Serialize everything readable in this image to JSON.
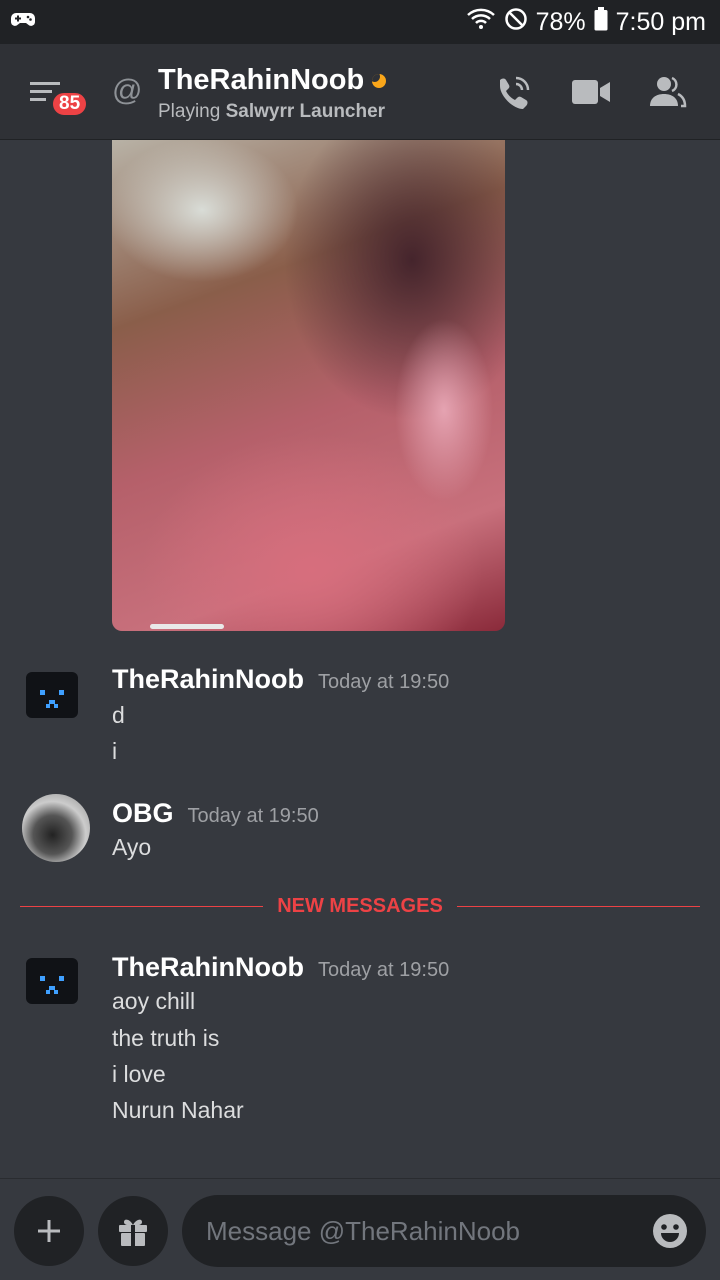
{
  "status_bar": {
    "app_icon": "gamepad-icon",
    "battery_percent": "78%",
    "time": "7:50 pm"
  },
  "header": {
    "notification_count": "85",
    "channel_symbol": "@",
    "username": "TheRahinNoob",
    "activity_prefix": "Playing",
    "activity_name": "Salwyrr Launcher",
    "status": "idle"
  },
  "messages": [
    {
      "author": "TheRahinNoob",
      "timestamp": "Today at 19:50",
      "lines": [
        "d",
        "i"
      ]
    },
    {
      "author": "OBG",
      "timestamp": "Today at 19:50",
      "lines": [
        "Ayo"
      ]
    },
    {
      "author": "TheRahinNoob",
      "timestamp": "Today at 19:50",
      "lines": [
        "aoy chill",
        "the truth is",
        "i love",
        "Nurun Nahar"
      ]
    }
  ],
  "divider_label": "NEW MESSAGES",
  "composer": {
    "placeholder": "Message @TheRahinNoob"
  },
  "colors": {
    "background": "#36393f",
    "header": "#2f3136",
    "accent_red": "#ed4245",
    "idle": "#faa61a"
  }
}
